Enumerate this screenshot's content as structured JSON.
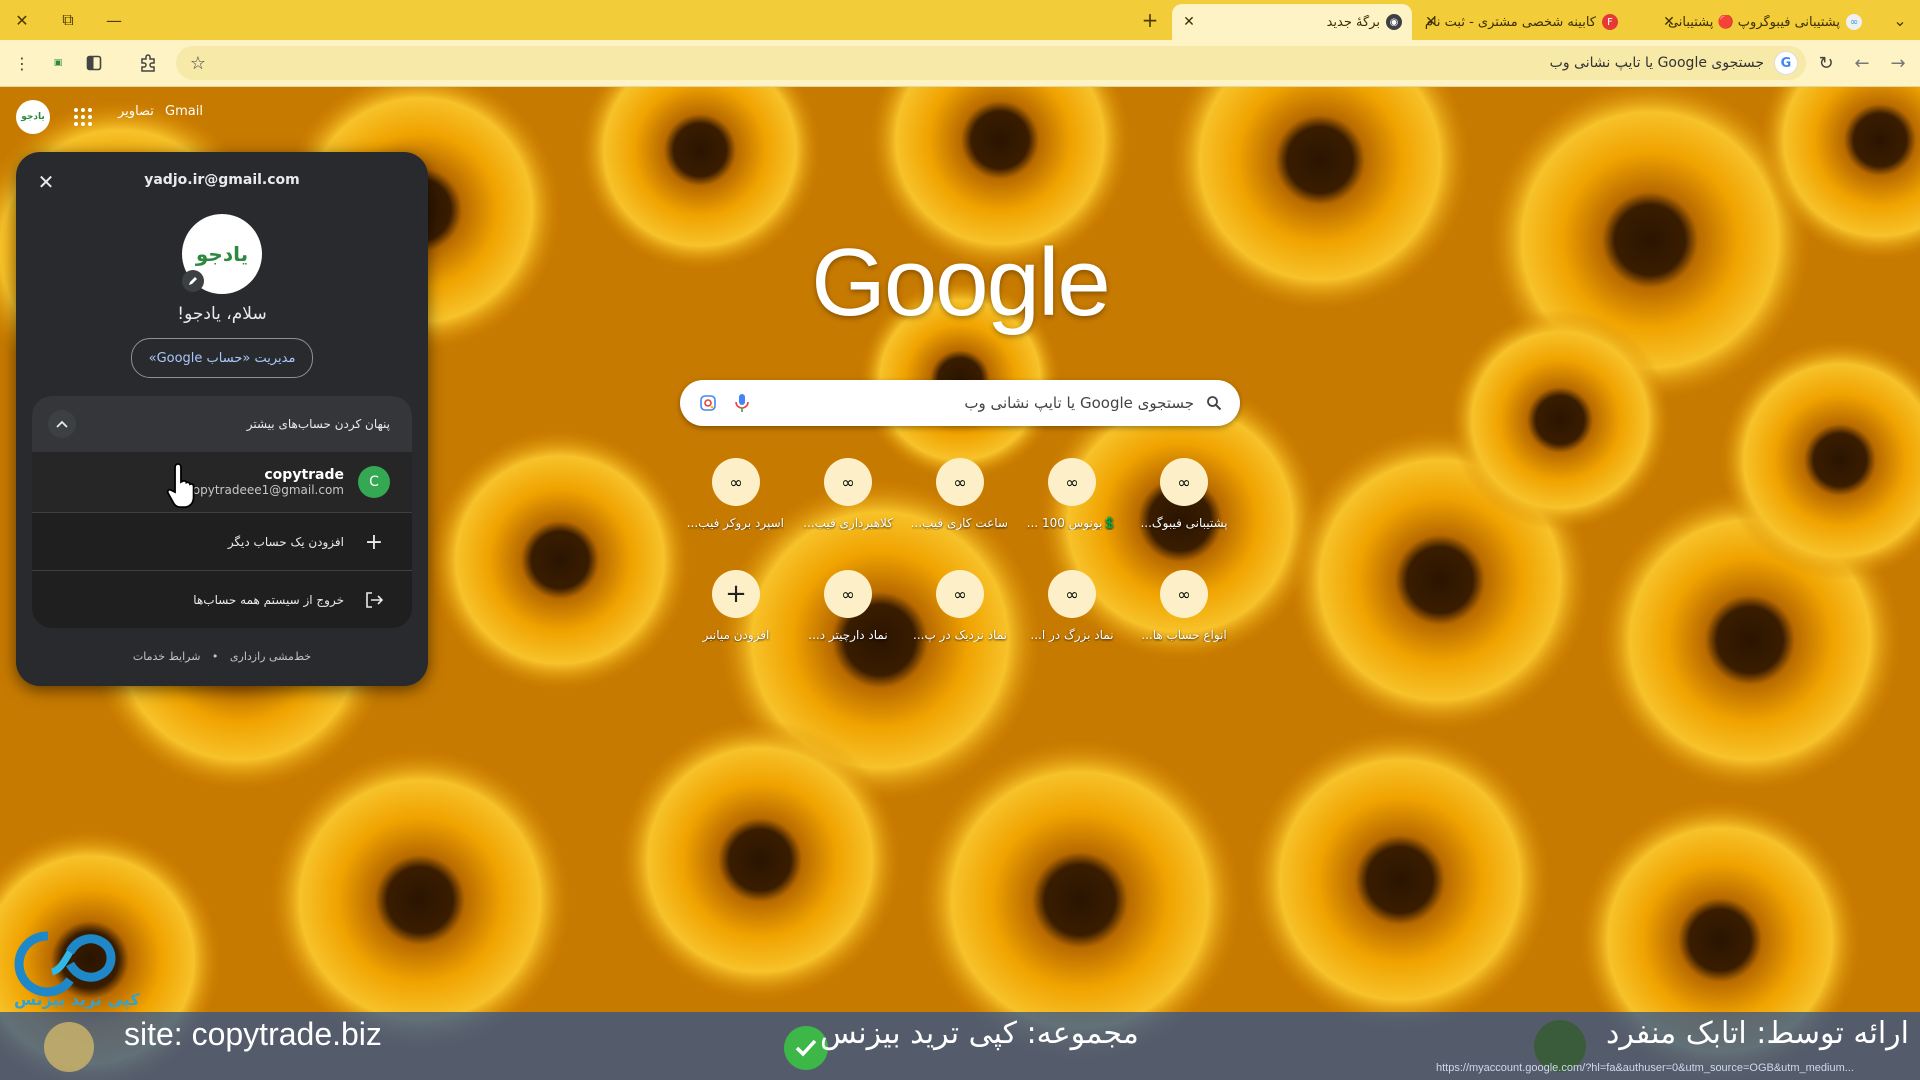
{
  "window": {
    "close": "✕",
    "restore": "⧉",
    "minimize": "—",
    "tab_search": "⌄"
  },
  "tabs": [
    {
      "title": "پشتیبانی فیبوگروپ 🔴 پشتیبانی",
      "fav_color": "#f0f0f0"
    },
    {
      "title": "کابینه شخصی مشتری - ثبت نام",
      "fav_color": "#e53935"
    },
    {
      "title": "برگهٔ جدید",
      "fav_color": "#3c4043",
      "active": true
    }
  ],
  "new_tab": "+",
  "toolbar": {
    "omnibox_text": "جستجوی Google یا تایپ نشانی وب"
  },
  "google_bar": {
    "gmail": "Gmail",
    "images": "تصاویر",
    "avatar_text": "یادجو"
  },
  "logo": "Google",
  "search": {
    "placeholder": "جستجوی Google یا تایپ نشانی وب"
  },
  "shortcuts_row1": [
    {
      "label": "پشتیبانی فیبوگ..."
    },
    {
      "label": "💲بونوس 100 ..."
    },
    {
      "label": "ساعت کاری فیب..."
    },
    {
      "label": "کلاهبرداری فیب..."
    },
    {
      "label": "اسپرد بروکر فیب..."
    }
  ],
  "shortcuts_row2": [
    {
      "label": "انواع حساب ها..."
    },
    {
      "label": "نماد بزرگ در ا..."
    },
    {
      "label": "نماد نزدیک در پ..."
    },
    {
      "label": "نماد دارچیتر د..."
    },
    {
      "label": "افزودن میانبر"
    }
  ],
  "panel": {
    "email": "yadjo.ir@gmail.com",
    "avatar_text": "یادجو",
    "greeting": "سلام، یادجو!",
    "manage_button": "مدیریت «حساب Google»",
    "hide_accounts": "پنهان کردن حساب‌های بیشتر",
    "account_name": "copytrade",
    "account_email": "copytradeee1@gmail.com",
    "account_initial": "C",
    "add_account": "افزودن یک حساب دیگر",
    "sign_out": "خروج از سیستم همه حساب‌ها",
    "privacy": "خط‌مشی رازداری",
    "dot": "•",
    "terms": "شرایط خدمات"
  },
  "watermark": {
    "text": "کپی ترید بیزنس"
  },
  "banner": {
    "site": "site: copytrade.biz",
    "collection": "مجموعه: کپی ترید بیزنس",
    "presenter": "ارائه توسط: اتابک منفرد",
    "status_url": "https://myaccount.google.com/?hl=fa&authuser=0&utm_source=OGB&utm_medium..."
  },
  "colors": {
    "tabstrip": "#f3cc3a",
    "toolbar": "#fdf3c4",
    "panel": "#292a2d",
    "link": "#a8c7fa",
    "account_avatar": "#34a853"
  }
}
